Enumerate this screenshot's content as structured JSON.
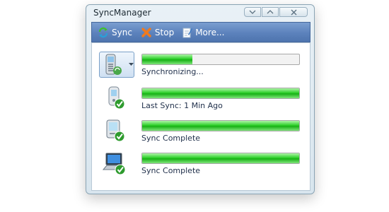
{
  "window": {
    "title": "SyncManager"
  },
  "toolbar": {
    "sync_label": "Sync",
    "stop_label": "Stop",
    "more_label": "More..."
  },
  "devices": [
    {
      "name": "phone-dropdown",
      "icon": "cellphone-sync-icon",
      "status": "Synchronizing...",
      "progress": 0.32
    },
    {
      "name": "pda",
      "icon": "pda-check-icon",
      "status": "Last Sync: 1 Min Ago",
      "progress": 1.0
    },
    {
      "name": "handheld",
      "icon": "handheld-check-icon",
      "status": "Sync Complete",
      "progress": 1.0
    },
    {
      "name": "laptop",
      "icon": "laptop-check-icon",
      "status": "Sync Complete",
      "progress": 1.0
    }
  ],
  "colors": {
    "toolbar": "#5c82bc",
    "progress": "#2fd02b"
  }
}
